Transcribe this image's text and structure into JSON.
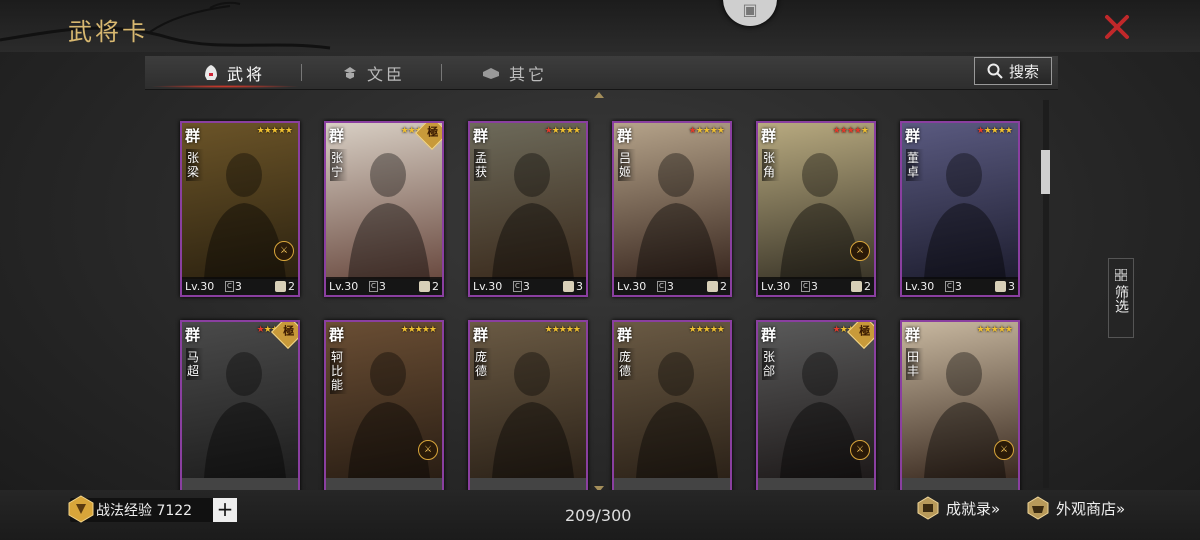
{
  "header": {
    "title": "武将卡"
  },
  "tabs": [
    {
      "label": "武将",
      "icon": "helmet-icon",
      "active": true
    },
    {
      "label": "文臣",
      "icon": "scholar-icon",
      "active": false
    },
    {
      "label": "其它",
      "icon": "box-icon",
      "active": false
    }
  ],
  "search": {
    "label": "搜索"
  },
  "filter": {
    "label": "筛选"
  },
  "cards": [
    {
      "faction": "群",
      "name": "张梁",
      "stars_red": 0,
      "stars_total": 5,
      "ji": false,
      "sp": true,
      "level": "Lv.30",
      "cost": "3",
      "troop": "2",
      "palette": [
        "#6b5428",
        "#2c2210"
      ]
    },
    {
      "faction": "群",
      "name": "张宁",
      "stars_red": 0,
      "stars_total": 5,
      "ji": true,
      "ji_label": "極",
      "sp": false,
      "level": "Lv.30",
      "cost": "3",
      "troop": "2",
      "palette": [
        "#d8cfc4",
        "#6a4a40"
      ]
    },
    {
      "faction": "群",
      "name": "孟获",
      "stars_red": 1,
      "stars_total": 5,
      "ji": false,
      "sp": false,
      "level": "Lv.30",
      "cost": "3",
      "troop": "3",
      "palette": [
        "#6d6a5a",
        "#3a2a1c"
      ]
    },
    {
      "faction": "群",
      "name": "吕姬",
      "stars_red": 1,
      "stars_total": 5,
      "ji": false,
      "sp": false,
      "level": "Lv.30",
      "cost": "3",
      "troop": "2",
      "palette": [
        "#b5a38a",
        "#3a2820"
      ]
    },
    {
      "faction": "群",
      "name": "张角",
      "stars_red": 4,
      "stars_total": 5,
      "ji": false,
      "sp": true,
      "level": "Lv.30",
      "cost": "3",
      "troop": "2",
      "palette": [
        "#b8aa80",
        "#3a3528"
      ]
    },
    {
      "faction": "群",
      "name": "董卓",
      "stars_red": 1,
      "stars_total": 5,
      "ji": false,
      "sp": false,
      "level": "Lv.30",
      "cost": "3",
      "troop": "3",
      "palette": [
        "#5a5a80",
        "#1e1e30"
      ]
    },
    {
      "faction": "群",
      "name": "马超",
      "stars_red": 1,
      "stars_total": 5,
      "ji": true,
      "ji_label": "極",
      "sp": false,
      "level": "",
      "cost": "",
      "troop": "",
      "palette": [
        "#4a4a4a",
        "#1e1e1e"
      ]
    },
    {
      "faction": "群",
      "name": "轲比能",
      "stars_red": 0,
      "stars_total": 5,
      "ji": false,
      "sp": true,
      "level": "",
      "cost": "",
      "troop": "",
      "palette": [
        "#6a4e34",
        "#2a1e14"
      ]
    },
    {
      "faction": "群",
      "name": "庞德",
      "stars_red": 0,
      "stars_total": 5,
      "ji": false,
      "sp": false,
      "level": "",
      "cost": "",
      "troop": "",
      "palette": [
        "#6a5a44",
        "#2c2218"
      ]
    },
    {
      "faction": "群",
      "name": "庞德",
      "stars_red": 0,
      "stars_total": 5,
      "ji": false,
      "sp": false,
      "level": "",
      "cost": "",
      "troop": "",
      "palette": [
        "#6a5a44",
        "#2c2218"
      ]
    },
    {
      "faction": "群",
      "name": "张郃",
      "stars_red": 1,
      "stars_total": 5,
      "ji": true,
      "ji_label": "極",
      "sp": true,
      "level": "",
      "cost": "",
      "troop": "",
      "palette": [
        "#5a5a5a",
        "#1e1a1a"
      ]
    },
    {
      "faction": "群",
      "name": "田丰",
      "stars_red": 0,
      "stars_total": 5,
      "ji": false,
      "sp": true,
      "level": "",
      "cost": "",
      "troop": "",
      "palette": [
        "#c8b8a0",
        "#3a2a20"
      ]
    }
  ],
  "footer": {
    "exp_label": "战法经验 7122",
    "plus": "+",
    "count": "209/300",
    "achievements": "成就录»",
    "shop": "外观商店»"
  },
  "colors": {
    "accent": "#d8b870",
    "card_border": "#8a3fa0",
    "close": "#c0282a"
  }
}
